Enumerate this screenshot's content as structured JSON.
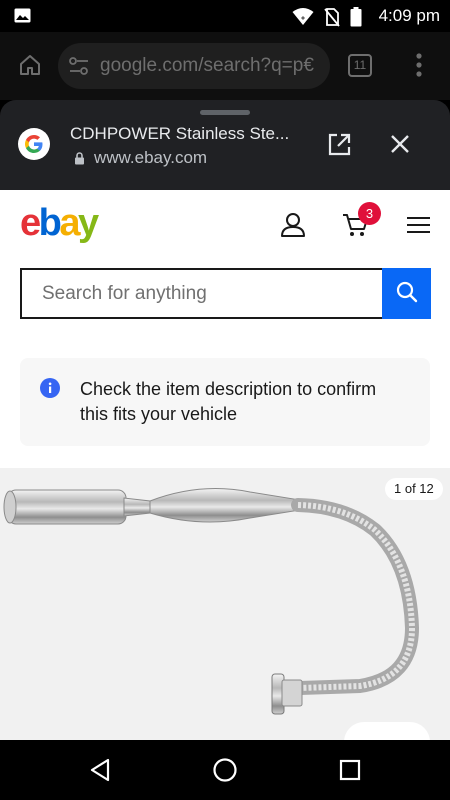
{
  "status_bar": {
    "time": "4:09 pm",
    "icons": [
      "image-icon",
      "wifi-icon",
      "no-sim-icon",
      "battery-icon"
    ]
  },
  "chrome": {
    "url": "google.com/search?q=p€",
    "tab_count": "11",
    "icons": [
      "home-icon",
      "tune-icon",
      "more-vert-icon"
    ]
  },
  "custom_tab": {
    "title": "CDHPOWER Stainless Ste...",
    "domain": "www.ebay.com",
    "icons": [
      "google-icon",
      "lock-icon",
      "open-in-new-icon",
      "close-icon"
    ]
  },
  "ebay": {
    "logo": {
      "e": "e",
      "b": "b",
      "a": "a",
      "y": "y"
    },
    "colors": {
      "e": "#e53238",
      "b": "#0064d2",
      "a": "#f5af02",
      "y": "#86b817",
      "search_button": "#0968f6",
      "badge": "#e0103a"
    },
    "cart_count": "3",
    "search": {
      "placeholder": "Search for anything",
      "value": ""
    },
    "notice": "Check the item description to confirm this fits your vehicle",
    "gallery": {
      "counter": "1 of 12"
    }
  },
  "nav": {
    "icons": [
      "back-triangle-icon",
      "home-circle-icon",
      "recents-square-icon"
    ]
  }
}
